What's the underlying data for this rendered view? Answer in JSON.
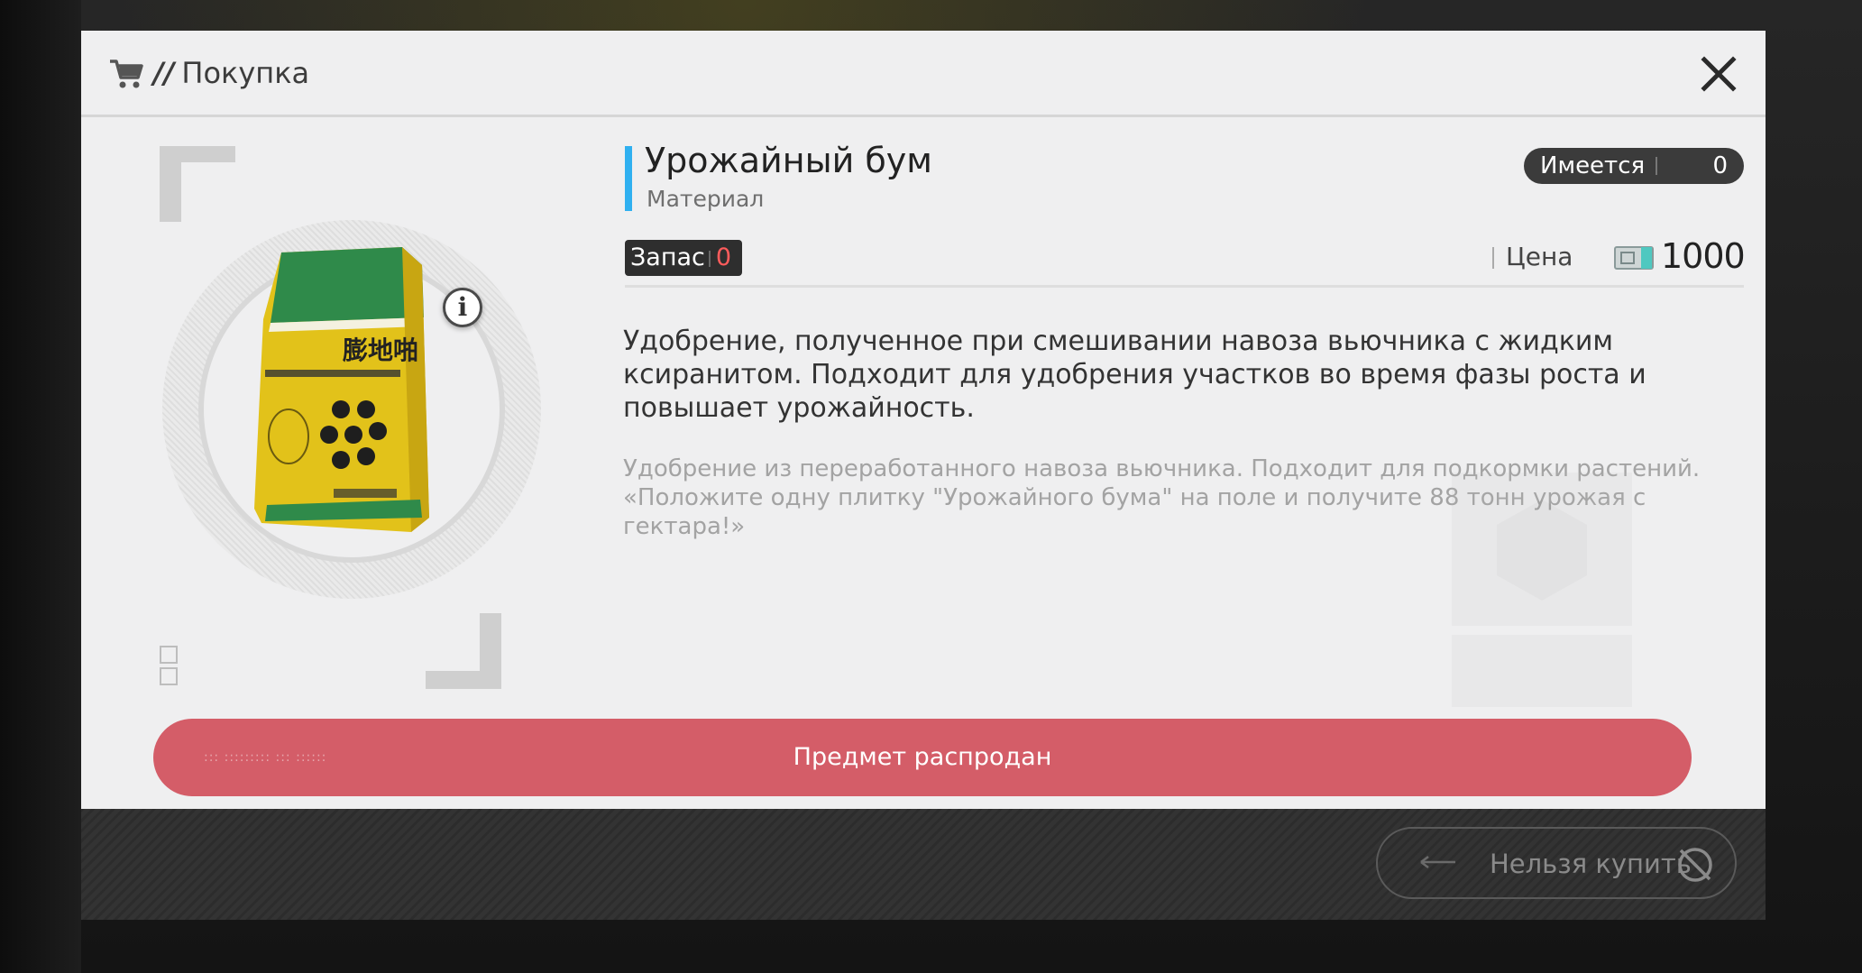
{
  "header": {
    "title_prefix": "//",
    "title": "Покупка"
  },
  "item": {
    "name": "Урожайный бум",
    "type": "Материал",
    "owned_label": "Имеется",
    "owned_value": "0",
    "stock_label": "Запас",
    "stock_value": "0",
    "price_label": "Цена",
    "price_value": "1000",
    "bag_text": "膨地啪",
    "description": "Удобрение, полученное при смешивании навоза вьючника с жидким ксиранитом. Подходит для удобрения участков во время фазы роста и повышает урожайность.",
    "flavor": "Удобрение из переработанного навоза вьючника. Подходит для подкормки растений. «Положите одну плитку \"Урожайного бума\" на поле и получите 88 тонн урожая с гектара!»"
  },
  "actions": {
    "soldout_label": "Предмет распродан",
    "buy_label": "Нельзя купить"
  },
  "icons": [
    "cart-icon",
    "close-icon",
    "info-icon",
    "currency-icon",
    "arrow-left-icon",
    "ban-icon"
  ],
  "colors": {
    "accent": "#2fb0f0",
    "soldout": "#d45d68",
    "stock_zero": "#ff5c5c"
  }
}
